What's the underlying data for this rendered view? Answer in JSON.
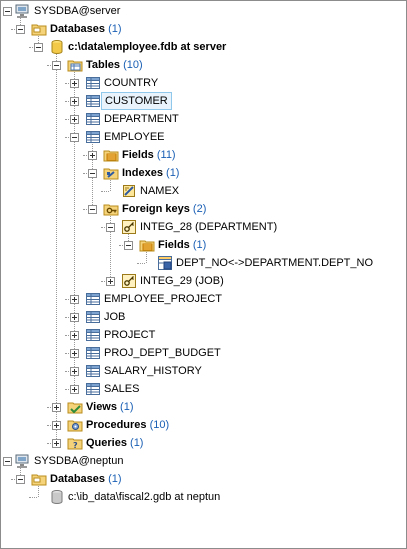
{
  "nodes": [
    {
      "name": "server-node-sysdba",
      "icon": "server-icon",
      "label": "SYSDBA@server",
      "count": "",
      "bold": false,
      "toggle": "minus"
    },
    {
      "name": "databases-node",
      "icon": "folder-icon",
      "label": "Databases",
      "count": "(1)",
      "bold": true,
      "toggle": "minus"
    },
    {
      "name": "database-node-employee",
      "icon": "database-icon",
      "label": "c:\\data\\employee.fdb at server",
      "count": "",
      "bold": true,
      "toggle": "minus"
    },
    {
      "name": "tables-node",
      "icon": "tables-folder-icon",
      "label": "Tables",
      "count": "(10)",
      "bold": true,
      "toggle": "minus"
    },
    {
      "name": "table-node-country",
      "icon": "table-icon",
      "label": "COUNTRY",
      "count": "",
      "bold": false,
      "toggle": "plus"
    },
    {
      "name": "table-node-customer",
      "icon": "table-icon",
      "label": "CUSTOMER",
      "count": "",
      "bold": false,
      "toggle": "plus",
      "selected": true
    },
    {
      "name": "table-node-department",
      "icon": "table-icon",
      "label": "DEPARTMENT",
      "count": "",
      "bold": false,
      "toggle": "plus"
    },
    {
      "name": "table-node-employee",
      "icon": "table-icon",
      "label": "EMPLOYEE",
      "count": "",
      "bold": false,
      "toggle": "minus"
    },
    {
      "name": "fields-node",
      "icon": "fields-icon",
      "label": "Fields",
      "count": "(11)",
      "bold": true,
      "toggle": "plus"
    },
    {
      "name": "indexes-node",
      "icon": "indexes-icon",
      "label": "Indexes",
      "count": "(1)",
      "bold": true,
      "toggle": "minus"
    },
    {
      "name": "index-node-namex",
      "icon": "index-icon",
      "label": "NAMEX",
      "count": "",
      "bold": false,
      "toggle": ""
    },
    {
      "name": "foreign-keys-node",
      "icon": "key-icon",
      "label": "Foreign keys",
      "count": "(2)",
      "bold": true,
      "toggle": "minus"
    },
    {
      "name": "fk-node-integ-28",
      "icon": "fk-icon",
      "label": "INTEG_28 (DEPARTMENT)",
      "count": "",
      "bold": false,
      "toggle": "minus"
    },
    {
      "name": "fk-fields-node",
      "icon": "fields-icon",
      "label": "Fields",
      "count": "(1)",
      "bold": true,
      "toggle": "minus"
    },
    {
      "name": "fk-field-node-dept-no",
      "icon": "field-link-icon",
      "label": "DEPT_NO<->DEPARTMENT.DEPT_NO",
      "count": "",
      "bold": false,
      "toggle": ""
    },
    {
      "name": "fk-node-integ-29",
      "icon": "fk-icon",
      "label": "INTEG_29 (JOB)",
      "count": "",
      "bold": false,
      "toggle": "plus"
    },
    {
      "name": "table-node-employee-project",
      "icon": "table-icon",
      "label": "EMPLOYEE_PROJECT",
      "count": "",
      "bold": false,
      "toggle": "plus"
    },
    {
      "name": "table-node-job",
      "icon": "table-icon",
      "label": "JOB",
      "count": "",
      "bold": false,
      "toggle": "plus"
    },
    {
      "name": "table-node-project",
      "icon": "table-icon",
      "label": "PROJECT",
      "count": "",
      "bold": false,
      "toggle": "plus"
    },
    {
      "name": "table-node-proj-dept-budget",
      "icon": "table-icon",
      "label": "PROJ_DEPT_BUDGET",
      "count": "",
      "bold": false,
      "toggle": "plus"
    },
    {
      "name": "table-node-salary-history",
      "icon": "table-icon",
      "label": "SALARY_HISTORY",
      "count": "",
      "bold": false,
      "toggle": "plus"
    },
    {
      "name": "table-node-sales",
      "icon": "table-icon",
      "label": "SALES",
      "count": "",
      "bold": false,
      "toggle": "plus"
    },
    {
      "name": "views-node",
      "icon": "views-icon",
      "label": "Views",
      "count": "(1)",
      "bold": true,
      "toggle": "plus"
    },
    {
      "name": "procedures-node",
      "icon": "procedures-icon",
      "label": "Procedures",
      "count": "(10)",
      "bold": true,
      "toggle": "plus"
    },
    {
      "name": "queries-node",
      "icon": "queries-icon",
      "label": "Queries",
      "count": "(1)",
      "bold": true,
      "toggle": "plus"
    },
    {
      "name": "server-node-neptun",
      "icon": "server-icon",
      "label": "SYSDBA@neptun",
      "count": "",
      "bold": false,
      "toggle": "minus"
    },
    {
      "name": "databases-node-neptun",
      "icon": "folder-icon",
      "label": "Databases",
      "count": "(1)",
      "bold": true,
      "toggle": "minus"
    },
    {
      "name": "database-node-fiscal2",
      "icon": "database-grey-icon",
      "label": "c:\\ib_data\\fiscal2.gdb at neptun",
      "count": "",
      "bold": false,
      "toggle": ""
    }
  ]
}
